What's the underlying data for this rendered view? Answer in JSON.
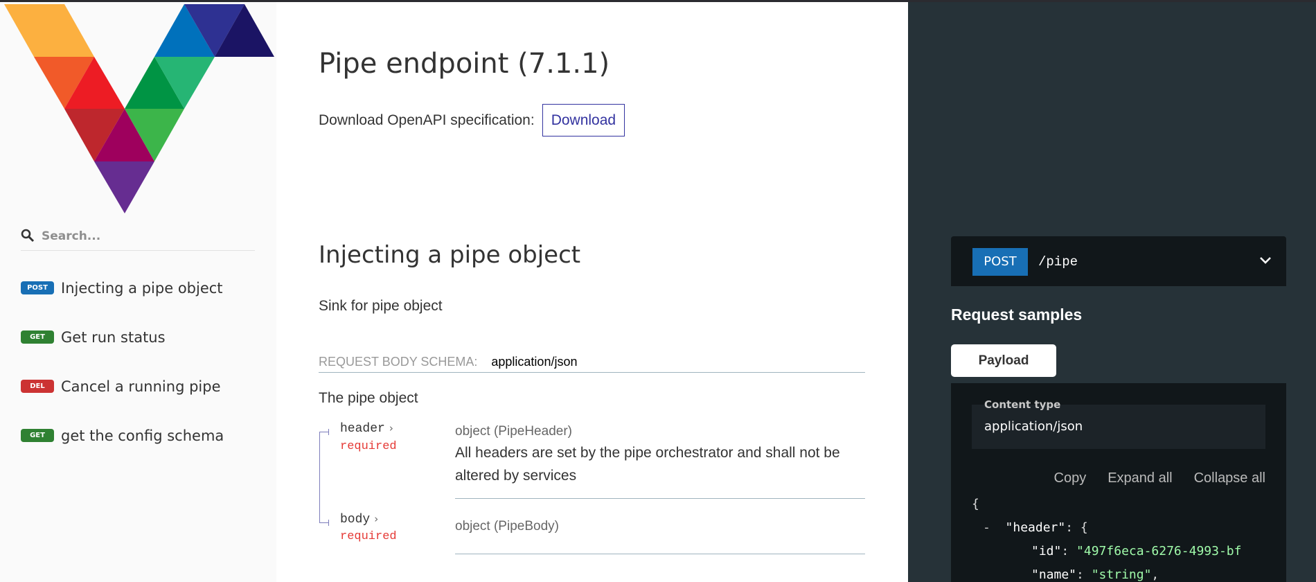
{
  "sidebar": {
    "logo": "multicolor-triangle-v-logo",
    "search": {
      "placeholder": "Search..."
    },
    "items": [
      {
        "method": "POST",
        "method_color": "#186fb5",
        "label": "Injecting a pipe object"
      },
      {
        "method": "GET",
        "method_color": "#2f8132",
        "label": "Get run status"
      },
      {
        "method": "DEL",
        "method_color": "#cc3333",
        "label": "Cancel a running pipe"
      },
      {
        "method": "GET",
        "method_color": "#2f8132",
        "label": "get the config schema"
      }
    ]
  },
  "main": {
    "title": "Pipe endpoint (7.1.1)",
    "download_label": "Download OpenAPI specification:",
    "download_button": "Download",
    "operation": {
      "title": "Injecting a pipe object",
      "description": "Sink for pipe object",
      "schema_label": "REQUEST BODY SCHEMA:",
      "schema_type": "application/json",
      "schema_description": "The pipe object",
      "properties": [
        {
          "name": "header",
          "required": "required",
          "type": "object (PipeHeader)",
          "description": "All headers are set by the pipe orchestrator and shall not be altered by services"
        },
        {
          "name": "body",
          "required": "required",
          "type": "object (PipeBody)",
          "description": ""
        }
      ]
    }
  },
  "right_panel": {
    "endpoint": {
      "method": "POST",
      "path": "/pipe"
    },
    "request_samples_title": "Request samples",
    "tabs": [
      {
        "label": "Payload",
        "active": true
      }
    ],
    "content_type_label": "Content type",
    "content_type_value": "application/json",
    "actions": {
      "copy": "Copy",
      "expand_all": "Expand all",
      "collapse_all": "Collapse all"
    },
    "code": {
      "open_brace": "{",
      "collapser": "-",
      "header_key": "\"header\"",
      "header_open": "{",
      "id_key": "\"id\"",
      "id_value": "\"497f6eca-6276-4993-bf",
      "name_key": "\"name\"",
      "name_value": "\"string\""
    }
  }
}
